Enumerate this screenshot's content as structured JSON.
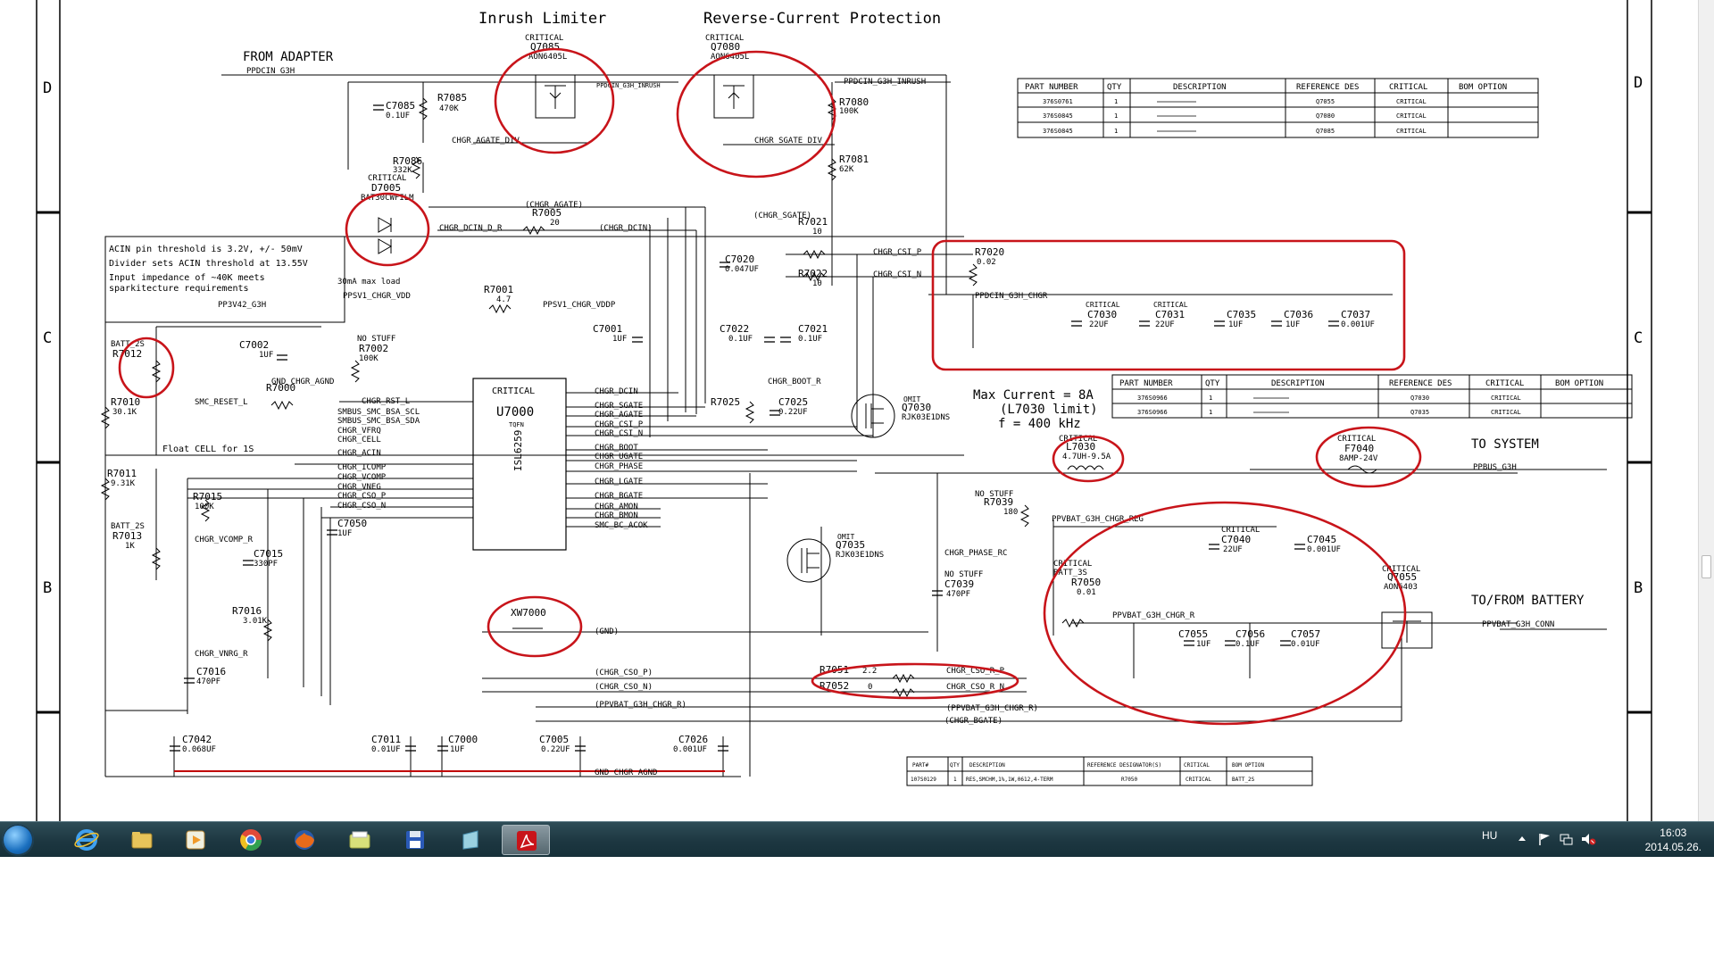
{
  "schematic": {
    "titles": {
      "inrush": "Inrush Limiter",
      "reverse": "Reverse-Current Protection",
      "from_adapter": "FROM ADAPTER",
      "to_system": "TO SYSTEM",
      "to_battery": "TO/FROM BATTERY",
      "max_current": "Max Current = 8A",
      "l_limit": "(L7030 limit)",
      "freq": "f = 400 kHz"
    },
    "zones": {
      "d": "D",
      "c": "C",
      "b": "B"
    },
    "nets": {
      "ppdcin": "PPDCIN_G3H",
      "ppdcin_inrush": "PPDCIN_G3H_INRUSH",
      "ppdcin_chgr": "PPDCIN_G3H_CHGR",
      "ppbus": "PPBUS_G3H",
      "ppvbat": "PPVBAT_G3H_CHGR_R",
      "ppvbat_reg": "PPVBAT_G3H_CHGR_REG",
      "ppvbat_conn": "PPVBAT_G3H_CONN",
      "pp3v42": "PP3V42_G3H",
      "ppsv1": "PPSV1_CHGR_VDD",
      "ppsv1_vddp": "PPSV1_CHGR_VDDP",
      "chgr_agate": "(CHGR_AGATE)",
      "chgr_agate_div": "CHGR_AGATE_DIV",
      "chgr_sgate": "(CHGR_SGATE)",
      "chgr_sgate_div": "CHGR_SGATE_DIV",
      "chgr_dcin": "(CHGR_DCIN)",
      "chgr_dcin_dr": "CHGR_DCIN_D_R",
      "chgr_csi_p": "CHGR_CSI_P",
      "chgr_csi_n": "CHGR_CSI_N",
      "chgr_boot_r": "CHGR_BOOT_R",
      "chgr_phase_rc": "CHGR_PHASE_RC",
      "chgr_cso_p": "(CHGR_CSO_P)",
      "chgr_cso_n": "(CHGR_CSO_N)",
      "chgr_cso_r_p": "CHGR_CSO_R_P",
      "chgr_cso_r_n": "CHGR_CSO_R_N",
      "ppvbat_r_paren": "(PPVBAT_G3H_CHGR_R)",
      "chgr_bgate_paren": "(CHGR_BGATE)",
      "gnd_paren": "(GND)",
      "gnd_chgr_agnd": "GND_CHGR_AGND",
      "smc_reset": "SMC_RESET_L",
      "float_cell": "Float CELL for 1S",
      "chgr_vcomp_r": "CHGR_VCOMP_R",
      "chgr_vnrg_r": "CHGR_VNRG_R",
      "ma_max_load": "30mA max load"
    },
    "acin_note": [
      "ACIN pin threshold is 3.2V, +/- 50mV",
      "Divider sets ACIN threshold at 13.55V",
      "Input impedance of ~40K meets",
      "sparkitecture requirements"
    ],
    "ic": {
      "ref": "U7000",
      "part": "ISL6259",
      "critical": "CRITICAL",
      "pkg": "TQFN",
      "left_pins": [
        "CHGR_RST_L",
        "SMBUS_SMC_BSA_SCL",
        "SMBUS_SMC_BSA_SDA",
        "CHGR_VFRQ",
        "CHGR_CELL",
        "CHGR_ACIN",
        "CHGR_ICOMP",
        "CHGR_VCOMP",
        "CHGR_VNEG",
        "CHGR_CSO_P",
        "CHGR_CSO_N"
      ],
      "right_pins": [
        "CHGR_DCIN",
        "CHGR_SGATE",
        "CHGR_AGATE",
        "CHGR_CSI_P",
        "CHGR_CSI_N",
        "CHGR_BOOT",
        "CHGR_UGATE",
        "CHGR_PHASE",
        "CHGR_LGATE",
        "CHGR_BGATE",
        "CHGR_AMON",
        "CHGR_BMON",
        "SMC_BC_ACOK"
      ]
    },
    "components": {
      "q7085": "Q7085",
      "q7085_part": "AON6405L",
      "q7080": "Q7080",
      "q7080_part": "AON6405L",
      "q7030": "Q7030",
      "q7030_part": "RJK03E1DNS",
      "q7035": "Q7035",
      "q7035_part": "RJK03E1DNS",
      "q7055": "Q7055",
      "q7055_part": "AON6403",
      "d7005": "D7005",
      "d7005_part": "BAT30CWFILM",
      "r7085": "R7085",
      "r7085_val": "470K",
      "r7086": "R7086",
      "r7086_val": "332K",
      "r7080": "R7080",
      "r7080_val": "100K",
      "r7081": "R7081",
      "r7081_val": "62K",
      "r7005": "R7005",
      "r7005_val": "20",
      "r7001": "R7001",
      "r7001_val": "4.7",
      "r7021": "R7021",
      "r7021_val": "10",
      "r7022": "R7022",
      "r7022_val": "10",
      "r7020": "R7020",
      "r7020_val": "0.02",
      "r7012": "R7012",
      "r7002": "R7002",
      "r7002_val": "100K",
      "r7000": "R7000",
      "r7010": "R7010",
      "r7010_val": "30.1K",
      "r7011": "R7011",
      "r7011_val": "9.31K",
      "r7013": "R7013",
      "r7013_val": "1K",
      "r7015": "R7015",
      "r7015_val": "100K",
      "r7016": "R7016",
      "r7016_val": "3.01K",
      "r7025": "R7025",
      "r7039": "R7039",
      "r7039_val": "180",
      "r7050": "R7050",
      "r7050_val": "0.01",
      "r7051": "R7051",
      "r7051_val": "2.2",
      "r7052": "R7052",
      "r7052_val": "0",
      "c7085": "C7085",
      "c7085_val": "0.1UF",
      "c7020": "C7020",
      "c7020_val": "0.047UF",
      "c7001": "C7001",
      "c7001_val": "1UF",
      "c7002": "C7002",
      "c7002_val": "1UF",
      "c7022": "C7022",
      "c7022_val": "0.1UF",
      "c7021": "C7021",
      "c7021_val": "0.1UF",
      "c7025": "C7025",
      "c7025_val": "0.22UF",
      "c7030": "C7030",
      "c7030_val": "22UF",
      "c7031": "C7031",
      "c7031_val": "22UF",
      "c7035": "C7035",
      "c7035_val": "1UF",
      "c7036": "C7036",
      "c7036_val": "1UF",
      "c7037": "C7037",
      "c7037_val": "0.001UF",
      "c7039": "C7039",
      "c7039_val": "470PF",
      "c7040": "C7040",
      "c7040_val": "22UF",
      "c7045": "C7045",
      "c7045_val": "0.001UF",
      "c7050": "C7050",
      "c7050_val": "1UF",
      "c7015": "C7015",
      "c7015_val": "330PF",
      "c7016": "C7016",
      "c7016_val": "470PF",
      "c7055": "C7055",
      "c7055_val": "1UF",
      "c7056": "C7056",
      "c7056_val": "0.1UF",
      "c7057": "C7057",
      "c7057_val": "0.01UF",
      "c7042": "C7042",
      "c7042_val": "0.068UF",
      "c7011": "C7011",
      "c7011_val": "0.01UF",
      "c7000": "C7000",
      "c7000_val": "1UF",
      "c7005": "C7005",
      "c7005_val": "0.22UF",
      "c7026": "C7026",
      "c7026_val": "0.001UF",
      "l7030": "L7030",
      "l7030_val": "4.7UH-9.5A",
      "f7040": "F7040",
      "f7040_val": "8AMP-24V",
      "xw7000": "XW7000",
      "critical": "CRITICAL",
      "no_stuff": "NO STUFF",
      "batt_2s": "BATT_2S",
      "batt_3s": "BATT_3S",
      "omit": "OMIT"
    },
    "bom_headers": [
      "PART NUMBER",
      "QTY",
      "DESCRIPTION",
      "REFERENCE DES",
      "CRITICAL",
      "BOM OPTION"
    ],
    "bom_table_1": [
      [
        "376S0761",
        "1",
        "",
        "Q7055",
        "CRITICAL",
        ""
      ],
      [
        "376S0845",
        "1",
        "",
        "Q7080",
        "CRITICAL",
        ""
      ],
      [
        "376S0845",
        "1",
        "",
        "Q7085",
        "CRITICAL",
        ""
      ]
    ],
    "bom_table_2": [
      [
        "376S0966",
        "1",
        "",
        "Q7030",
        "CRITICAL",
        ""
      ],
      [
        "376S0966",
        "1",
        "",
        "Q7035",
        "CRITICAL",
        ""
      ]
    ],
    "bom3_headers": [
      "PART#",
      "QTY",
      "DESCRIPTION",
      "REFERENCE DESIGNATOR(S)",
      "CRITICAL",
      "BOM OPTION"
    ],
    "bom_table_3": [
      [
        "107S0129",
        "1",
        "RES,SMCHM,1%,1W,0612,4-TERM",
        "R7050",
        "CRITICAL",
        "BATT_2S"
      ]
    ]
  },
  "taskbar": {
    "apps": [
      {
        "name": "internet-explorer",
        "color": "#2a8fe0"
      },
      {
        "name": "file-explorer",
        "color": "#e8c45a"
      },
      {
        "name": "media-player",
        "color": "#f09a2a"
      },
      {
        "name": "chrome",
        "color": "#e04a3a"
      },
      {
        "name": "firefox",
        "color": "#e86a1a"
      },
      {
        "name": "folder-app",
        "color": "#d8e07a"
      },
      {
        "name": "save-app",
        "color": "#2a5ab8"
      },
      {
        "name": "notes-app",
        "color": "#9ad0e0"
      },
      {
        "name": "acrobat-reader",
        "color": "#c8141a"
      }
    ],
    "active_index": 8,
    "language": "HU",
    "time": "16:03",
    "date": "2014.05.26."
  }
}
